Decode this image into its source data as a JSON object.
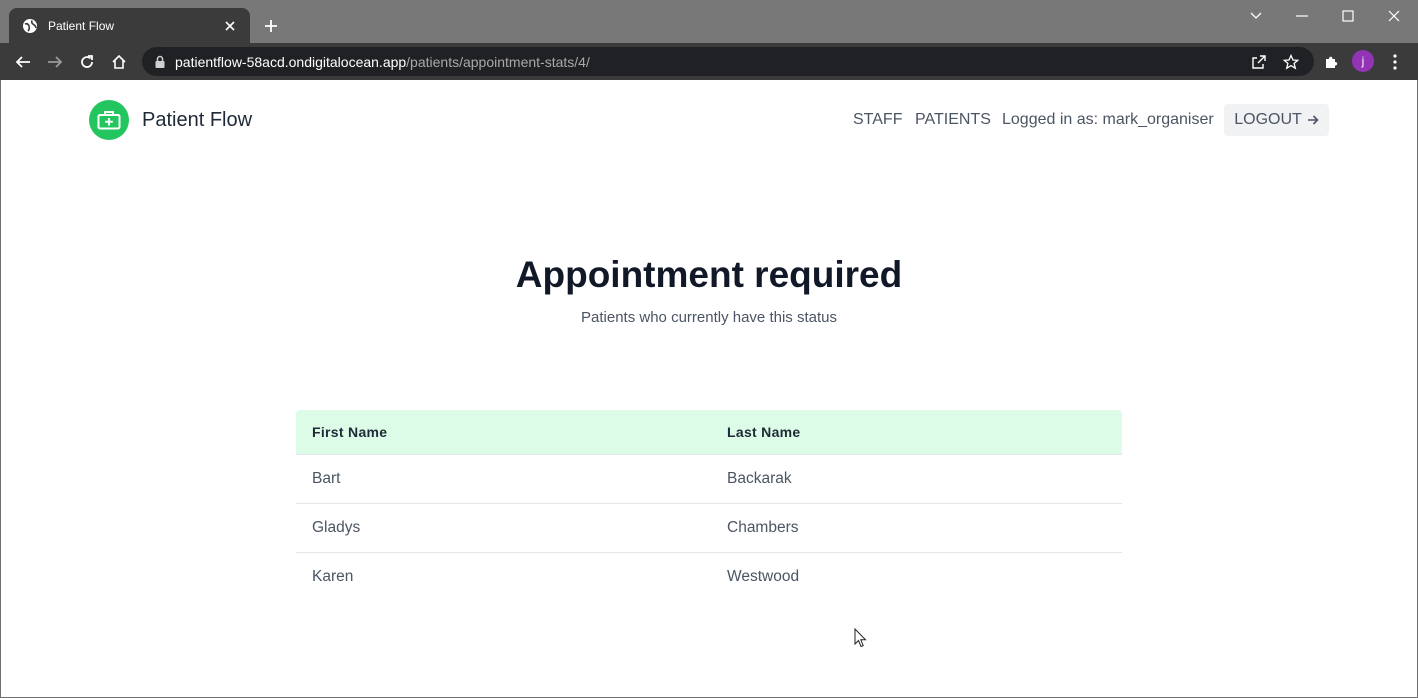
{
  "browser": {
    "tab_title": "Patient Flow",
    "url_host": "patientflow-58acd.ondigitalocean.app",
    "url_path": "/patients/appointment-stats/4/",
    "profile_initial": "j"
  },
  "header": {
    "brand_name": "Patient Flow",
    "nav": {
      "staff": "STAFF",
      "patients": "PATIENTS",
      "logged_in": "Logged in as: mark_organiser",
      "logout": "LOGOUT"
    }
  },
  "main": {
    "title": "Appointment required",
    "subtitle": "Patients who currently have this status",
    "table": {
      "headers": [
        "First Name",
        "Last Name"
      ],
      "rows": [
        [
          "Bart",
          "Backarak"
        ],
        [
          "Gladys",
          "Chambers"
        ],
        [
          "Karen",
          "Westwood"
        ]
      ]
    }
  },
  "colors": {
    "accent": "#22c55e",
    "table_header_bg": "#dcfce7"
  }
}
